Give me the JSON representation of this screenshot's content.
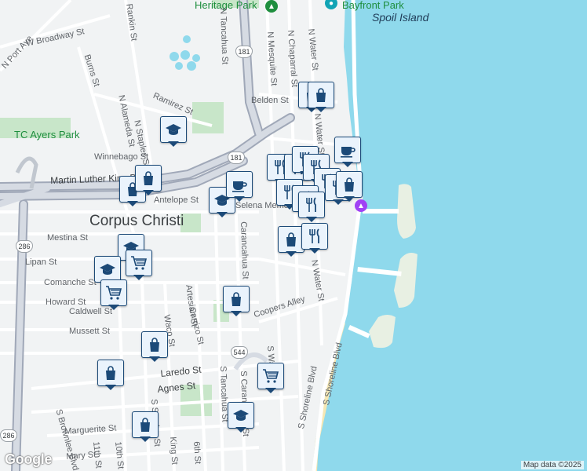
{
  "map": {
    "city_label": "Corpus Christi",
    "attribution": "Map data ©2025",
    "logo_text": "Google",
    "water_labels": [
      "Spoil Island"
    ],
    "park_labels": [
      "TC Ayers Park",
      "Heritage Park",
      "Bayfront Park"
    ],
    "street_labels": [
      "W Broadway St",
      "N Port Ave",
      "Rankin St",
      "Burns St",
      "N Alameda St",
      "Ramirez St",
      "N Staples St",
      "Winnebago St",
      "Martin Luther King Dr",
      "N Tancahua St",
      "Antelope St",
      "Mestina St",
      "Lipan St",
      "Comanche St",
      "Howard St",
      "Caldwell St",
      "Mussett St",
      "Artesian St",
      "Carrizo St",
      "Waco St",
      "Carancahua St",
      "Coopers Alley",
      "Laredo St",
      "Agnes St",
      "Marguerite St",
      "Mary St",
      "S Brownlee Blvd",
      "11th St",
      "10th St",
      "S Staples St",
      "King St",
      "6th St",
      "S Tancahua St",
      "S Carancahua St",
      "S Water St",
      "S Shoreline Blvd",
      "N Mesquite St",
      "N Chaparral St",
      "N Water St",
      "Belden St",
      "Selena Memorial"
    ],
    "shields": [
      "181",
      "181",
      "286",
      "286",
      "544"
    ],
    "poi_icons": [
      "park-tree-icon",
      "attraction-icon",
      "museum-pin-icon"
    ],
    "markers": [
      {
        "type": "shopping",
        "icon": "shopping-bag-icon"
      },
      {
        "type": "shopping",
        "icon": "shopping-bag-icon"
      },
      {
        "type": "education",
        "icon": "graduation-cap-icon"
      },
      {
        "type": "shopping",
        "icon": "shopping-bag-icon"
      },
      {
        "type": "shopping",
        "icon": "shopping-bag-icon"
      },
      {
        "type": "education",
        "icon": "graduation-cap-icon"
      },
      {
        "type": "cafe",
        "icon": "coffee-cup-icon"
      },
      {
        "type": "cafe",
        "icon": "coffee-cup-icon"
      },
      {
        "type": "restaurant",
        "icon": "fork-knife-icon"
      },
      {
        "type": "restaurant",
        "icon": "fork-knife-icon"
      },
      {
        "type": "restaurant",
        "icon": "fork-knife-icon"
      },
      {
        "type": "restaurant",
        "icon": "fork-knife-icon"
      },
      {
        "type": "restaurant",
        "icon": "fork-knife-icon"
      },
      {
        "type": "restaurant",
        "icon": "fork-knife-icon"
      },
      {
        "type": "shopping",
        "icon": "shopping-bag-icon"
      },
      {
        "type": "restaurant",
        "icon": "fork-knife-icon"
      },
      {
        "type": "restaurant",
        "icon": "fork-knife-icon"
      },
      {
        "type": "restaurant",
        "icon": "fork-knife-icon"
      },
      {
        "type": "shopping",
        "icon": "shopping-bag-icon"
      },
      {
        "type": "restaurant",
        "icon": "fork-knife-icon"
      },
      {
        "type": "education",
        "icon": "graduation-cap-icon"
      },
      {
        "type": "education",
        "icon": "graduation-cap-icon"
      },
      {
        "type": "grocery",
        "icon": "shopping-cart-icon"
      },
      {
        "type": "grocery",
        "icon": "shopping-cart-icon"
      },
      {
        "type": "shopping",
        "icon": "shopping-bag-icon"
      },
      {
        "type": "shopping",
        "icon": "shopping-bag-icon"
      },
      {
        "type": "shopping",
        "icon": "shopping-bag-icon"
      },
      {
        "type": "grocery",
        "icon": "shopping-cart-icon"
      },
      {
        "type": "education",
        "icon": "graduation-cap-icon"
      },
      {
        "type": "shopping",
        "icon": "shopping-bag-icon"
      }
    ],
    "colors": {
      "water": "#8fd9ec",
      "park": "#c8e6c9",
      "marker_border": "#1c4a78",
      "marker_fill": "#eaf3fc"
    }
  }
}
